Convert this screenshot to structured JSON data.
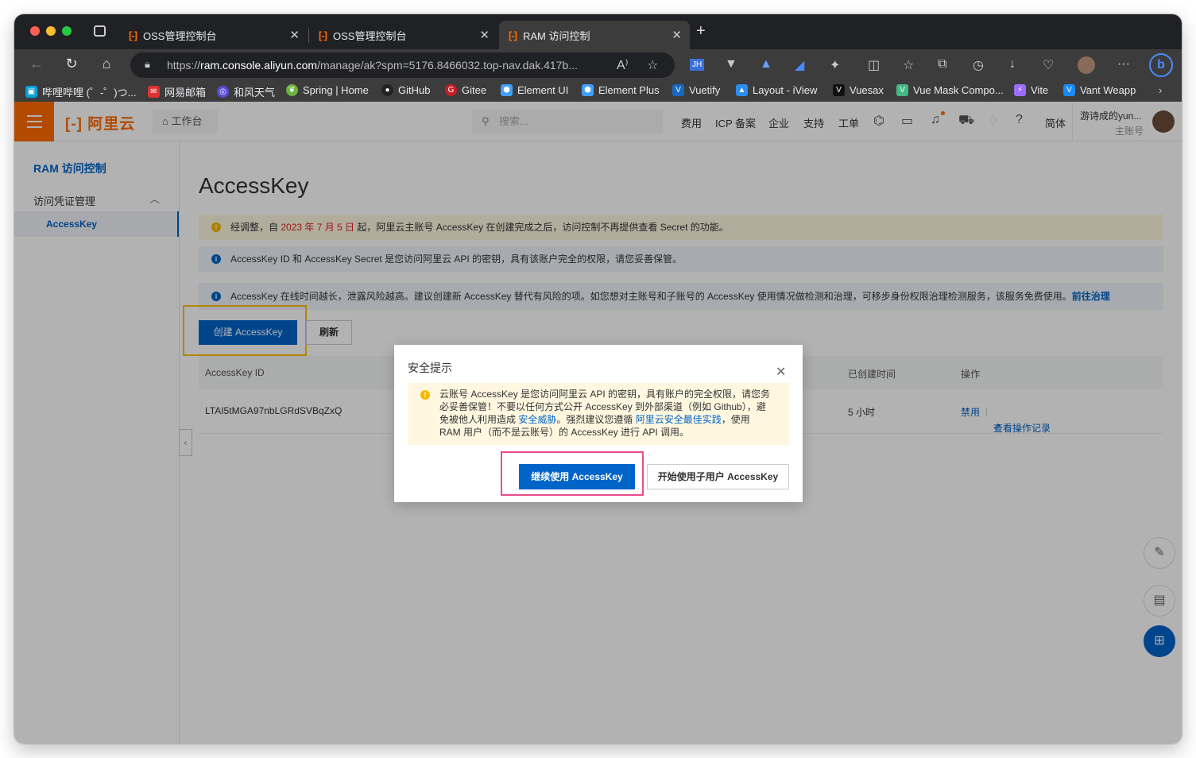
{
  "browser": {
    "tabs": [
      {
        "favicon": "[-]",
        "title": "OSS管理控制台"
      },
      {
        "favicon": "[-]",
        "title": "OSS管理控制台"
      },
      {
        "favicon": "[-]",
        "title": "RAM 访问控制"
      }
    ],
    "url_prefix": "https://",
    "url_host": "ram.console.aliyun.com",
    "url_rest": "/manage/ak?spm=5176.8466032.top-nav.dak.417b...",
    "bookmarks": [
      "哔哩哔哩 (゜-゜)つ...",
      "网易邮箱",
      "和风天气",
      "Spring | Home",
      "GitHub",
      "Gitee",
      "Element UI",
      "Element Plus",
      "Vuetify",
      "Layout - iView",
      "Vuesax",
      "Vue Mask Compo...",
      "Vite",
      "Vant Weapp"
    ]
  },
  "console": {
    "logo": "[-] 阿里云",
    "workbench": "工作台",
    "search_placeholder": "搜索...",
    "nav": [
      "费用",
      "ICP 备案",
      "企业",
      "支持",
      "工单"
    ],
    "lang": "简体",
    "username": "游诗成的yun...",
    "user_role": "主账号"
  },
  "sidebar": {
    "title": "RAM 访问控制",
    "group": "访问凭证管理",
    "item": "AccessKey"
  },
  "main": {
    "page_title": "AccessKey",
    "alert_warn_pre": "经调整，自 ",
    "alert_warn_date": "2023 年 7 月 5 日",
    "alert_warn_post": " 起，阿里云主账号 AccessKey 在创建完成之后，访问控制不再提供查看 Secret 的功能。",
    "alert_info1": "AccessKey ID 和 AccessKey Secret 是您访问阿里云 API 的密钥，具有该账户完全的权限，请您妥善保管。",
    "alert_info2": "AccessKey 在线时间越长，泄露风险越高。建议创建新 AccessKey 替代有风险的项。如您想对主账号和子账号的 AccessKey 使用情况做检测和治理，可移步身份权限治理检测服务，该服务免费使用。",
    "alert_info2_link": "前往治理",
    "btn_create": "创建 AccessKey",
    "btn_refresh": "刷新",
    "table_headers": {
      "id": "AccessKey ID",
      "created": "已创建时间",
      "ops": "操作"
    },
    "rows": [
      {
        "id": "LTAI5tMGA97nbLGRdSVBqZxQ",
        "created": "5 小时",
        "op_disable": "禁用",
        "op_log": "查看操作记录"
      }
    ]
  },
  "dialog": {
    "title": "安全提示",
    "msg_1": "云账号 AccessKey 是您访问阿里云 API 的密钥，具有账户的完全权限，请您务必妥善保管！不要以任何方式公开 AccessKey 到外部渠道（例如 Github），避免被他人利用造成 ",
    "msg_link1": "安全威胁",
    "msg_2": "。强烈建议您遵循 ",
    "msg_link2": "阿里云安全最佳实践",
    "msg_3": "，使用 RAM 用户（而不是云账号）的 AccessKey 进行 API 调用。",
    "btn_continue": "继续使用 AccessKey",
    "btn_subuser": "开始使用子用户 AccessKey"
  },
  "colors": {
    "accent": "#0064c8",
    "brand": "#ff6a00",
    "highlight_yellow": "#ffc107",
    "highlight_pink": "#e94b8b"
  }
}
